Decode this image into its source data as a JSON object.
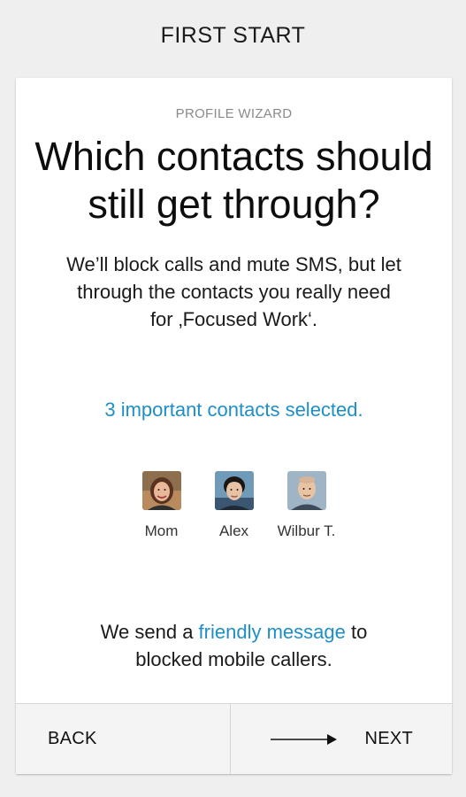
{
  "header": {
    "title": "FIRST START"
  },
  "wizard": {
    "label": "PROFILE WIZARD",
    "headline_line1": "Which contacts should",
    "headline_line2": "still get through?",
    "description_line1": "We’ll block calls and mute SMS, but let",
    "description_line2": "through the contacts you really need",
    "description_line3": "for  ‚Focused Work‘.",
    "selection_summary": "3 important contacts selected."
  },
  "contacts": [
    {
      "name": "Mom",
      "icon": "avatar-mom"
    },
    {
      "name": "Alex",
      "icon": "avatar-alex"
    },
    {
      "name": "Wilbur T.",
      "icon": "avatar-wilbur"
    }
  ],
  "footer_note": {
    "prefix": "We send a ",
    "link": "friendly message",
    "suffix": " to",
    "line2": "blocked mobile callers."
  },
  "nav": {
    "back_label": "BACK",
    "next_label": "NEXT",
    "next_icon": "arrow-right-icon"
  },
  "colors": {
    "accent": "#1e8fc6",
    "background": "#efefef",
    "card": "#ffffff"
  }
}
